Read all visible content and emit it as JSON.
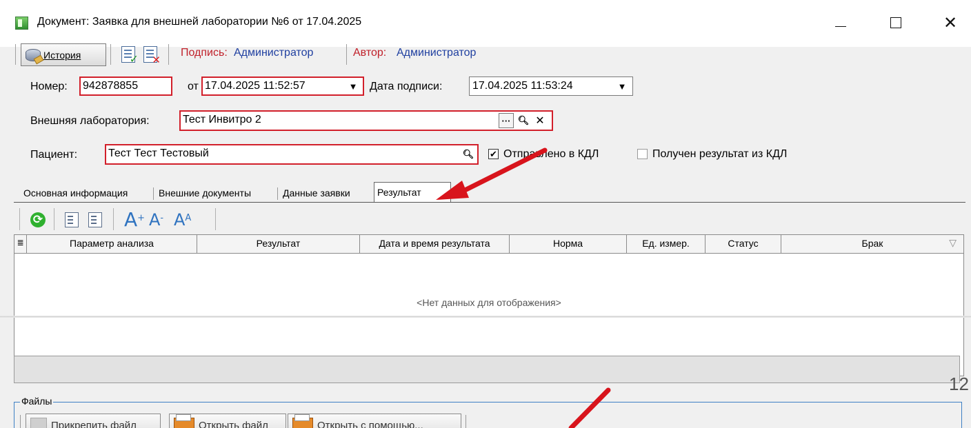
{
  "window": {
    "title": "Документ: Заявка для внешней лаборатории №6 от 17.04.2025"
  },
  "toolbar": {
    "history_label": "История",
    "signature_label": "Подпись:",
    "signature_value": "Администратор",
    "author_label": "Автор:",
    "author_value": "Администратор"
  },
  "form": {
    "number_label": "Номер:",
    "number_value": "942878855",
    "from_label": "от",
    "from_value": "17.04.2025 11:52:57",
    "sign_date_label": "Дата подписи:",
    "sign_date_value": "17.04.2025 11:53:24",
    "lab_label": "Внешняя лаборатория:",
    "lab_value": "Тест Инвитро 2",
    "patient_label": "Пациент:",
    "patient_value": "Тест Тест Тестовый",
    "sent_label": "Отправлено в КДЛ",
    "sent_checked": true,
    "received_label": "Получен результат из КДЛ",
    "received_checked": false
  },
  "tabs": [
    {
      "label": "Основная информация",
      "active": false
    },
    {
      "label": "Внешние документы",
      "active": false
    },
    {
      "label": "Данные заявки",
      "active": false
    },
    {
      "label": "Результат",
      "active": true
    }
  ],
  "grid": {
    "columns": [
      "Параметр анализа",
      "Результат",
      "Дата и время результата",
      "Норма",
      "Ед. измер.",
      "Статус",
      "Брак"
    ],
    "empty_text": "<Нет данных для отображения>"
  },
  "files": {
    "legend": "Файлы",
    "buttons": [
      "Прикрепить файл",
      "Открыть файл",
      "Открыть с помощью..."
    ]
  },
  "page_number": "12",
  "colors": {
    "required_border": "#d21f2a",
    "link_blue": "#1f3fa0",
    "label_red": "#c0202a",
    "arrow_red": "#d8141c",
    "group_border": "#3c7fc4"
  }
}
